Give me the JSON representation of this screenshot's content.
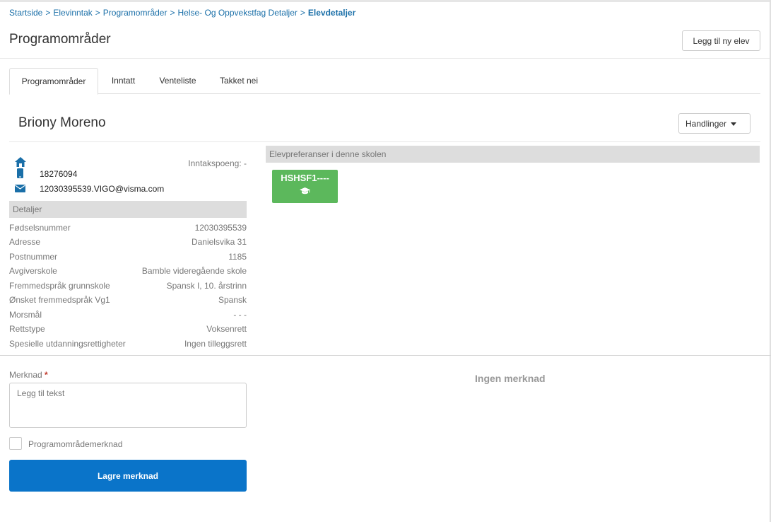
{
  "breadcrumb": {
    "items": [
      "Startside",
      "Elevinntak",
      "Programområder",
      "Helse- Og Oppvekstfag Detaljer"
    ],
    "separator": ">",
    "current": "Elevdetaljer"
  },
  "page_title": "Programområder",
  "add_student_label": "Legg til ny elev",
  "tabs": [
    {
      "label": "Programområder",
      "active": true
    },
    {
      "label": "Inntatt",
      "active": false
    },
    {
      "label": "Venteliste",
      "active": false
    },
    {
      "label": "Takket nei",
      "active": false
    }
  ],
  "student": {
    "name": "Briony Moreno",
    "actions_label": "Handlinger",
    "intake_points": "Inntakspoeng: -",
    "phone": "18276094",
    "email": "12030395539.VIGO@visma.com",
    "icons": {
      "address": "home-icon",
      "phone": "mobile-phone-icon",
      "email": "envelope-icon"
    }
  },
  "details": {
    "heading": "Detaljer",
    "rows": [
      {
        "label": "Fødselsnummer",
        "value": "12030395539"
      },
      {
        "label": "Adresse",
        "value": "Danielsvika 31"
      },
      {
        "label": "Postnummer",
        "value": "1185"
      },
      {
        "label": "Avgiverskole",
        "value": "Bamble videregående skole"
      },
      {
        "label": "Fremmedspråk grunnskole",
        "value": "Spansk I, 10. årstrinn"
      },
      {
        "label": "Ønsket fremmedspråk Vg1",
        "value": "Spansk"
      },
      {
        "label": "Morsmål",
        "value": "- - -"
      },
      {
        "label": "Rettstype",
        "value": "Voksenrett"
      },
      {
        "label": "Spesielle utdanningsrettigheter",
        "value": "Ingen tilleggsrett"
      }
    ]
  },
  "preferences": {
    "heading": "Elevpreferanser i denne skolen",
    "programs": [
      {
        "code": "HSHSF1----",
        "icon": "graduation-cap-icon",
        "color": "#5cb85c"
      }
    ]
  },
  "note": {
    "label": "Merknad",
    "required_mark": "*",
    "placeholder": "Legg til tekst",
    "value": "",
    "checkbox_label": "Programområdemerknad",
    "checkbox_checked": false,
    "save_label": "Lagre merknad",
    "empty_text": "Ingen merknad"
  },
  "colors": {
    "link": "#1a6fa8",
    "primary": "#0a74c9",
    "success": "#5cb85c",
    "required": "#c0392b"
  }
}
